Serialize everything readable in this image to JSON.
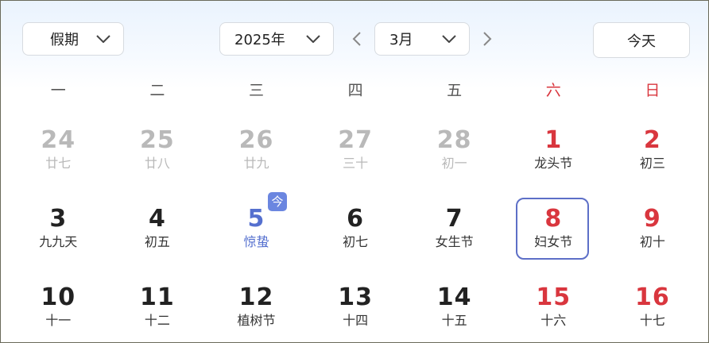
{
  "toolbar": {
    "holiday_label": "假期",
    "year_value": "2025年",
    "month_value": "3月",
    "today_button": "今天"
  },
  "weekdays": [
    "一",
    "二",
    "三",
    "四",
    "五",
    "六",
    "日"
  ],
  "today_badge": "今",
  "colors": {
    "weekend_red": "#d9363e",
    "today_blue": "#5570cf",
    "selected_border": "#5d6fc7",
    "badge_bg": "#6b86e0",
    "other_month_gray": "#b9b9b9"
  },
  "icons": {
    "dropdown": "chevron-down-icon",
    "prev": "chevron-left-icon",
    "next": "chevron-right-icon"
  },
  "days": [
    {
      "day": "24",
      "lunar": "廿七",
      "state": "other"
    },
    {
      "day": "25",
      "lunar": "廿八",
      "state": "other"
    },
    {
      "day": "26",
      "lunar": "廿九",
      "state": "other"
    },
    {
      "day": "27",
      "lunar": "三十",
      "state": "other"
    },
    {
      "day": "28",
      "lunar": "初一",
      "state": "other"
    },
    {
      "day": "1",
      "lunar": "龙头节",
      "state": "red"
    },
    {
      "day": "2",
      "lunar": "初三",
      "state": "red"
    },
    {
      "day": "3",
      "lunar": "九九天",
      "state": "normal"
    },
    {
      "day": "4",
      "lunar": "初五",
      "state": "normal"
    },
    {
      "day": "5",
      "lunar": "惊蛰",
      "state": "today"
    },
    {
      "day": "6",
      "lunar": "初七",
      "state": "normal"
    },
    {
      "day": "7",
      "lunar": "女生节",
      "state": "normal"
    },
    {
      "day": "8",
      "lunar": "妇女节",
      "state": "red selected"
    },
    {
      "day": "9",
      "lunar": "初十",
      "state": "red"
    },
    {
      "day": "10",
      "lunar": "十一",
      "state": "normal"
    },
    {
      "day": "11",
      "lunar": "十二",
      "state": "normal"
    },
    {
      "day": "12",
      "lunar": "植树节",
      "state": "normal"
    },
    {
      "day": "13",
      "lunar": "十四",
      "state": "normal"
    },
    {
      "day": "14",
      "lunar": "十五",
      "state": "normal"
    },
    {
      "day": "15",
      "lunar": "十六",
      "state": "red"
    },
    {
      "day": "16",
      "lunar": "十七",
      "state": "red"
    }
  ]
}
